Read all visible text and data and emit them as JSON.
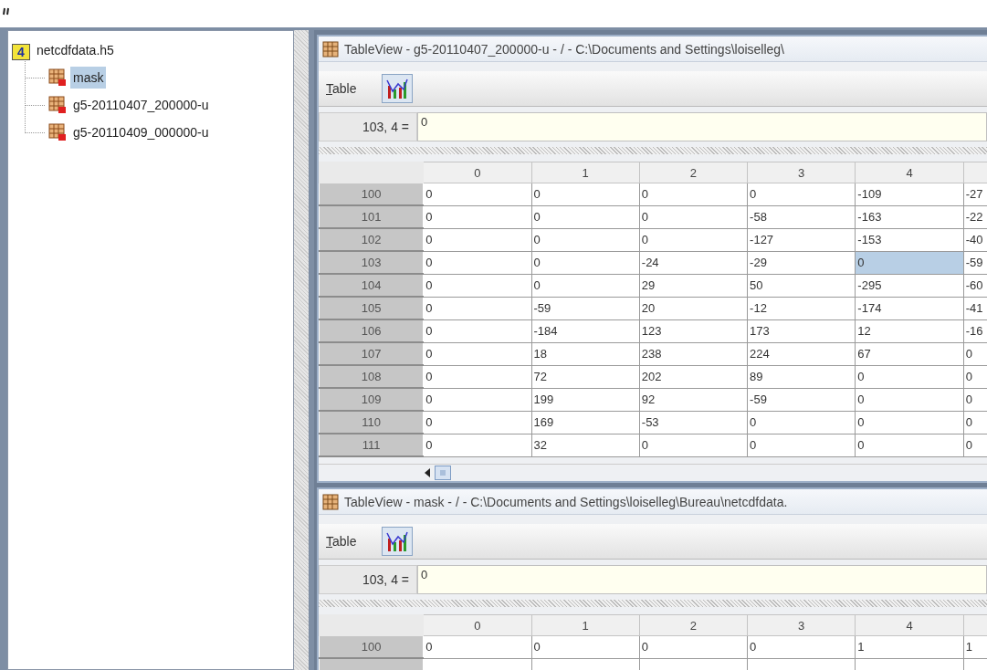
{
  "tree": {
    "icon_text": "4",
    "label": "netcdfdata.h5",
    "children": [
      {
        "label": "mask",
        "selected": true
      },
      {
        "label": "g5-20110407_200000-u",
        "selected": false
      },
      {
        "label": "g5-20110409_000000-u",
        "selected": false
      }
    ]
  },
  "frames": [
    {
      "title": "TableView  -  g5-20110407_200000-u  -  /  -  C:\\Documents and Settings\\loiselleg\\",
      "menu": "Table",
      "cell_ref": "103, 4  =",
      "cell_value": "0",
      "columns": [
        "0",
        "1",
        "2",
        "3",
        "4"
      ],
      "scrollbar": true,
      "rows": [
        {
          "header": "100",
          "cells": [
            {
              "v": "0",
              "selected": false
            },
            {
              "v": "0",
              "selected": false
            },
            {
              "v": "0",
              "selected": false
            },
            {
              "v": "0",
              "selected": false
            },
            {
              "v": "-109",
              "selected": false
            },
            {
              "v": "-27",
              "selected": false
            }
          ]
        },
        {
          "header": "101",
          "cells": [
            {
              "v": "0",
              "selected": false
            },
            {
              "v": "0",
              "selected": false
            },
            {
              "v": "0",
              "selected": false
            },
            {
              "v": "-58",
              "selected": false
            },
            {
              "v": "-163",
              "selected": false
            },
            {
              "v": "-22",
              "selected": false
            }
          ]
        },
        {
          "header": "102",
          "cells": [
            {
              "v": "0",
              "selected": false
            },
            {
              "v": "0",
              "selected": false
            },
            {
              "v": "0",
              "selected": false
            },
            {
              "v": "-127",
              "selected": false
            },
            {
              "v": "-153",
              "selected": false
            },
            {
              "v": "-40",
              "selected": false
            }
          ]
        },
        {
          "header": "103",
          "cells": [
            {
              "v": "0",
              "selected": false
            },
            {
              "v": "0",
              "selected": false
            },
            {
              "v": "-24",
              "selected": false
            },
            {
              "v": "-29",
              "selected": false
            },
            {
              "v": "0",
              "selected": true
            },
            {
              "v": "-59",
              "selected": false
            }
          ]
        },
        {
          "header": "104",
          "cells": [
            {
              "v": "0",
              "selected": false
            },
            {
              "v": "0",
              "selected": false
            },
            {
              "v": "29",
              "selected": false
            },
            {
              "v": "50",
              "selected": false
            },
            {
              "v": "-295",
              "selected": false
            },
            {
              "v": "-60",
              "selected": false
            }
          ]
        },
        {
          "header": "105",
          "cells": [
            {
              "v": "0",
              "selected": false
            },
            {
              "v": "-59",
              "selected": false
            },
            {
              "v": "20",
              "selected": false
            },
            {
              "v": "-12",
              "selected": false
            },
            {
              "v": "-174",
              "selected": false
            },
            {
              "v": "-41",
              "selected": false
            }
          ]
        },
        {
          "header": "106",
          "cells": [
            {
              "v": "0",
              "selected": false
            },
            {
              "v": "-184",
              "selected": false
            },
            {
              "v": "123",
              "selected": false
            },
            {
              "v": "173",
              "selected": false
            },
            {
              "v": "12",
              "selected": false
            },
            {
              "v": "-16",
              "selected": false
            }
          ]
        },
        {
          "header": "107",
          "cells": [
            {
              "v": "0",
              "selected": false
            },
            {
              "v": "18",
              "selected": false
            },
            {
              "v": "238",
              "selected": false
            },
            {
              "v": "224",
              "selected": false
            },
            {
              "v": "67",
              "selected": false
            },
            {
              "v": "0",
              "selected": false
            }
          ]
        },
        {
          "header": "108",
          "cells": [
            {
              "v": "0",
              "selected": false
            },
            {
              "v": "72",
              "selected": false
            },
            {
              "v": "202",
              "selected": false
            },
            {
              "v": "89",
              "selected": false
            },
            {
              "v": "0",
              "selected": false
            },
            {
              "v": "0",
              "selected": false
            }
          ]
        },
        {
          "header": "109",
          "cells": [
            {
              "v": "0",
              "selected": false
            },
            {
              "v": "199",
              "selected": false
            },
            {
              "v": "92",
              "selected": false
            },
            {
              "v": "-59",
              "selected": false
            },
            {
              "v": "0",
              "selected": false
            },
            {
              "v": "0",
              "selected": false
            }
          ]
        },
        {
          "header": "110",
          "cells": [
            {
              "v": "0",
              "selected": false
            },
            {
              "v": "169",
              "selected": false
            },
            {
              "v": "-53",
              "selected": false
            },
            {
              "v": "0",
              "selected": false
            },
            {
              "v": "0",
              "selected": false
            },
            {
              "v": "0",
              "selected": false
            }
          ]
        },
        {
          "header": "111",
          "cells": [
            {
              "v": "0",
              "selected": false
            },
            {
              "v": "32",
              "selected": false
            },
            {
              "v": "0",
              "selected": false
            },
            {
              "v": "0",
              "selected": false
            },
            {
              "v": "0",
              "selected": false
            },
            {
              "v": "0",
              "selected": false
            }
          ]
        }
      ]
    },
    {
      "title": "TableView  -  mask  -  /  -  C:\\Documents and Settings\\loiselleg\\Bureau\\netcdfdata.",
      "menu": "Table",
      "cell_ref": "103, 4  =",
      "cell_value": "0",
      "columns": [
        "0",
        "1",
        "2",
        "3",
        "4"
      ],
      "scrollbar": false,
      "rows": [
        {
          "header": "100",
          "cells": [
            {
              "v": "0",
              "selected": false
            },
            {
              "v": "0",
              "selected": false
            },
            {
              "v": "0",
              "selected": false
            },
            {
              "v": "0",
              "selected": false
            },
            {
              "v": "1",
              "selected": false
            },
            {
              "v": "1",
              "selected": false
            }
          ]
        }
      ]
    }
  ]
}
